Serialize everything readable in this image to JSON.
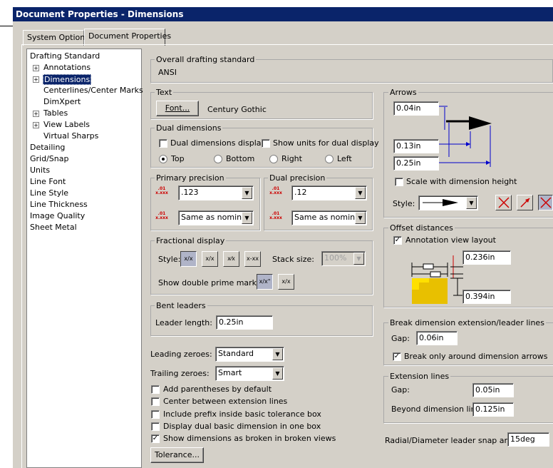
{
  "window": {
    "title": "Document Properties - Dimensions"
  },
  "tabs": [
    {
      "label": "System Options"
    },
    {
      "label": "Document Properties"
    }
  ],
  "tree": {
    "items": [
      "Drafting Standard",
      "Annotations",
      "Dimensions",
      "Centerlines/Center Marks",
      "DimXpert",
      "Tables",
      "View Labels",
      "Virtual Sharps",
      "Detailing",
      "Grid/Snap",
      "Units",
      "Line Font",
      "Line Style",
      "Line Thickness",
      "Image Quality",
      "Sheet Metal"
    ]
  },
  "overall": {
    "label": "Overall drafting standard",
    "value": "ANSI"
  },
  "text": {
    "label": "Text",
    "font_button": "Font...",
    "font_name": "Century Gothic"
  },
  "dual": {
    "label": "Dual dimensions",
    "display": "Dual dimensions display",
    "show_units": "Show units for dual display",
    "top": "Top",
    "bottom": "Bottom",
    "right": "Right",
    "left": "Left"
  },
  "primary": {
    "label": "Primary precision",
    "value1": ".123",
    "value2": "Same as nominal"
  },
  "dualprec": {
    "label": "Dual precision",
    "value1": ".12",
    "value2": "Same as nominal"
  },
  "fractional": {
    "label": "Fractional display",
    "style_label": "Style:",
    "stack_label": "Stack size:",
    "stack_value": "100%",
    "prime_label": "Show double prime mark (\"):"
  },
  "bent": {
    "label": "Bent leaders",
    "length_label": "Leader length:",
    "length_value": "0.25in"
  },
  "zeroes": {
    "leading_label": "Leading zeroes:",
    "leading_value": "Standard",
    "trailing_label": "Trailing zeroes:",
    "trailing_value": "Smart"
  },
  "checks": {
    "parens": "Add parentheses by default",
    "center": "Center between extension lines",
    "prefix": "Include prefix inside basic tolerance box",
    "dualbasic": "Display dual basic dimension in one box",
    "broken": "Show dimensions as broken in broken views"
  },
  "tolerance_button": "Tolerance...",
  "arrows": {
    "label": "Arrows",
    "v1": "0.04in",
    "v2": "0.13in",
    "v3": "0.25in",
    "scale": "Scale with dimension height",
    "style_label": "Style:"
  },
  "offset": {
    "label": "Offset distances",
    "annotation": "Annotation view layout",
    "v1": "0.236in",
    "v2": "0.394in"
  },
  "break": {
    "label": "Break dimension extension/leader lines",
    "gap_label": "Gap:",
    "gap_value": "0.06in",
    "only": "Break only around dimension arrows"
  },
  "ext": {
    "label": "Extension lines",
    "gap_label": "Gap:",
    "gap_value": "0.05in",
    "beyond_label": "Beyond dimension line:",
    "beyond_value": "0.125in"
  },
  "radial": {
    "label": "Radial/Diameter leader snap angle:",
    "value": "15deg"
  },
  "glyphs": {
    "fraction1": "x/x",
    "fraction2": "x/x",
    "fraction3": "x⁄x",
    "fraction4": "x-xx",
    "prime1": "x/x\"",
    "prime2": "x/x",
    "prec_icon": ".01 x.xxx"
  }
}
